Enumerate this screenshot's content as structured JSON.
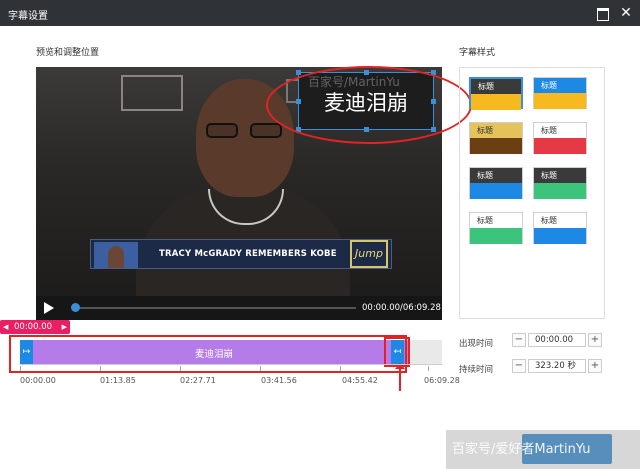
{
  "window": {
    "title": "字幕设置"
  },
  "preview": {
    "section_label": "预览和调整位置",
    "subtitle_text": "麦迪泪崩",
    "watermark": "百家号/MartinYu",
    "lower_third_text": "TRACY McGRADY REMEMBERS KOBE",
    "logo_text": "Jump",
    "time_display": "00:00.00/06:09.28"
  },
  "timeline": {
    "current_time": "00:00.00",
    "clip_label": "麦迪泪崩",
    "ticks": [
      "00:00.00",
      "01:13.85",
      "02:27.71",
      "03:41.56",
      "04:55.42",
      "06:09.28"
    ]
  },
  "styles": {
    "section_label": "字幕样式",
    "swatches": [
      {
        "label": "标题",
        "top": "#3a3a3a",
        "text": "#ffffff",
        "bottom": "#f6b91f"
      },
      {
        "label": "标题",
        "top": "#1e88e5",
        "text": "#ffffff",
        "bottom": "#f6b91f"
      },
      {
        "label": "标题",
        "top": "#e3c35a",
        "text": "#333333",
        "bottom": "#6b3f12"
      },
      {
        "label": "标题",
        "top": "#ffffff",
        "text": "#333333",
        "bottom": "#e63946"
      },
      {
        "label": "标题",
        "top": "#3a3a3a",
        "text": "#ffffff",
        "bottom": "#1e88e5"
      },
      {
        "label": "标题",
        "top": "#3a3a3a",
        "text": "#ffffff",
        "bottom": "#3cc47c"
      },
      {
        "label": "标题",
        "top": "#ffffff",
        "text": "#333333",
        "bottom": "#3cc47c"
      },
      {
        "label": "标题",
        "top": "#ffffff",
        "text": "#333333",
        "bottom": "#1e88e5"
      }
    ]
  },
  "fields": {
    "appear_label": "出现时间",
    "appear_value": "00:00.00",
    "duration_label": "持续时间",
    "duration_value": "323.20 秒"
  },
  "footer": {
    "watermark": "百家号/爱好者MartinYu"
  },
  "colors": {
    "accent": "#3b8fd6",
    "clip": "#b57be8",
    "annotation": "#e02424",
    "playhead": "#e91e63"
  }
}
